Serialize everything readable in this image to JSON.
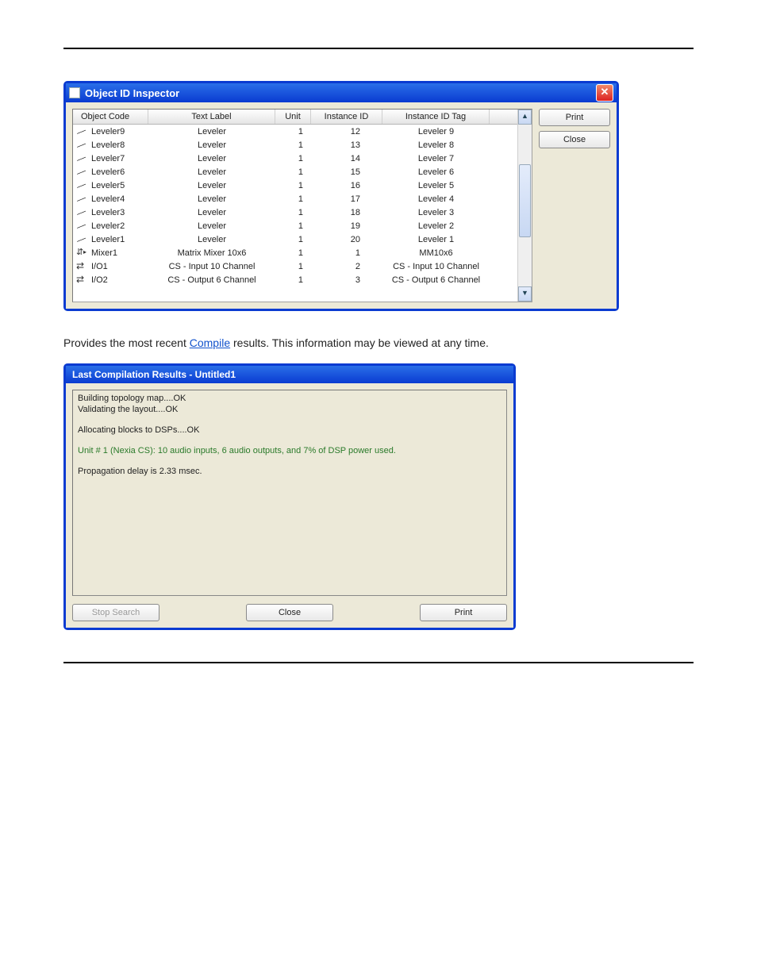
{
  "inspector": {
    "title": "Object ID Inspector",
    "close_glyph": "✕",
    "headers": {
      "object_code": "Object Code",
      "text_label": "Text Label",
      "unit": "Unit",
      "instance_id": "Instance ID",
      "instance_id_tag": "Instance ID Tag"
    },
    "rows": [
      {
        "icon": "curve",
        "code": "Leveler9",
        "label": "Leveler",
        "unit": "1",
        "iid": "12",
        "tag": "Leveler 9"
      },
      {
        "icon": "curve",
        "code": "Leveler8",
        "label": "Leveler",
        "unit": "1",
        "iid": "13",
        "tag": "Leveler 8"
      },
      {
        "icon": "curve",
        "code": "Leveler7",
        "label": "Leveler",
        "unit": "1",
        "iid": "14",
        "tag": "Leveler 7"
      },
      {
        "icon": "curve",
        "code": "Leveler6",
        "label": "Leveler",
        "unit": "1",
        "iid": "15",
        "tag": "Leveler 6"
      },
      {
        "icon": "curve",
        "code": "Leveler5",
        "label": "Leveler",
        "unit": "1",
        "iid": "16",
        "tag": "Leveler 5"
      },
      {
        "icon": "curve",
        "code": "Leveler4",
        "label": "Leveler",
        "unit": "1",
        "iid": "17",
        "tag": "Leveler 4"
      },
      {
        "icon": "curve",
        "code": "Leveler3",
        "label": "Leveler",
        "unit": "1",
        "iid": "18",
        "tag": "Leveler 3"
      },
      {
        "icon": "curve",
        "code": "Leveler2",
        "label": "Leveler",
        "unit": "1",
        "iid": "19",
        "tag": "Leveler 2"
      },
      {
        "icon": "curve",
        "code": "Leveler1",
        "label": "Leveler",
        "unit": "1",
        "iid": "20",
        "tag": "Leveler 1"
      },
      {
        "icon": "mixer",
        "code": "Mixer1",
        "label": "Matrix Mixer 10x6",
        "unit": "1",
        "iid": "1",
        "tag": "MM10x6"
      },
      {
        "icon": "io",
        "code": "I/O1",
        "label": "CS - Input 10 Channel",
        "unit": "1",
        "iid": "2",
        "tag": "CS - Input 10 Channel"
      },
      {
        "icon": "io",
        "code": "I/O2",
        "label": "CS - Output 6 Channel",
        "unit": "1",
        "iid": "3",
        "tag": "CS - Output 6 Channel"
      }
    ],
    "buttons": {
      "print": "Print",
      "close": "Close"
    },
    "scroll": {
      "up": "▲",
      "down": "▼"
    }
  },
  "description": {
    "before": "Provides the most recent ",
    "link": "Compile",
    "after": " results. This information may be viewed at any time."
  },
  "compile": {
    "title": "Last Compilation Results - Untitled1",
    "log": {
      "l1": "Building topology map....OK",
      "l2": "Validating the layout....OK",
      "l3": "Allocating blocks to DSPs....OK",
      "l4": "Unit # 1 (Nexia CS): 10 audio inputs,  6 audio outputs, and  7% of DSP power used.",
      "l5": "Propagation delay is 2.33 msec."
    },
    "buttons": {
      "stop": "Stop Search",
      "close": "Close",
      "print": "Print"
    }
  }
}
